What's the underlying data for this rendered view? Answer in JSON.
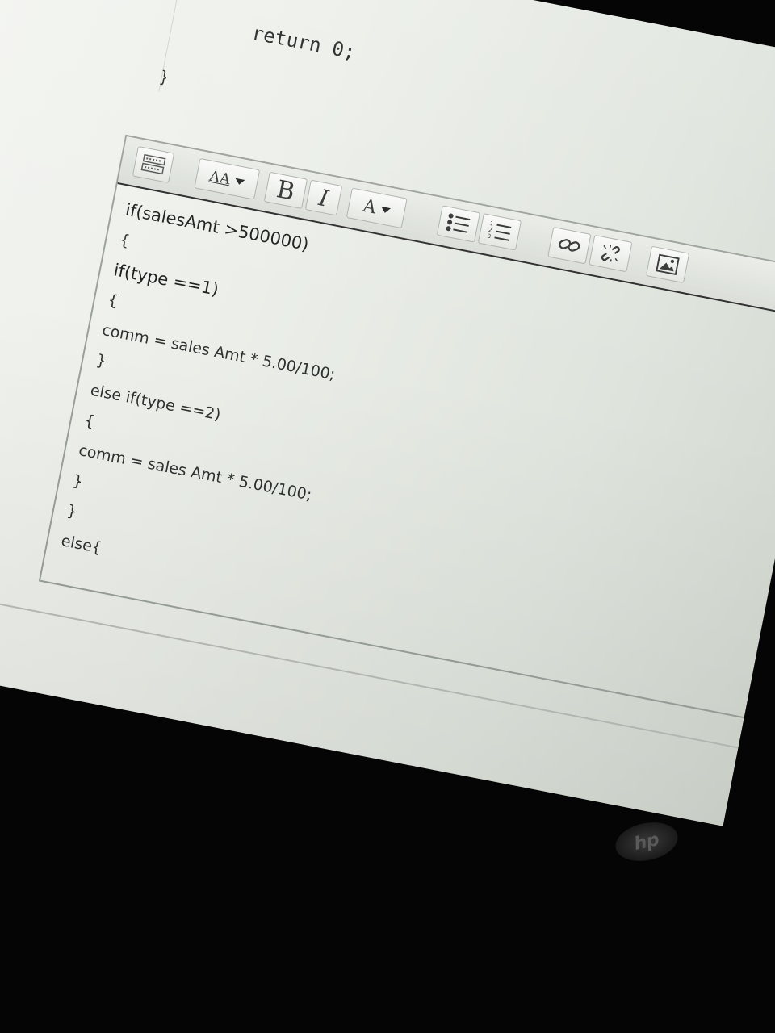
{
  "code_above": {
    "return_line": "return 0;",
    "closing_brace": "}"
  },
  "toolbar": {
    "format_icon": "keyboard-toggle-icon",
    "font_size_label": "AA",
    "bold_label": "B",
    "italic_label": "I",
    "font_color_label": "A",
    "unordered_list_icon": "bullet-list-icon",
    "ordered_list_icon": "numbered-list-icon",
    "link_icon": "link-icon",
    "unlink_icon": "unlink-icon",
    "image_icon": "image-icon"
  },
  "editor": {
    "lines": [
      "if(salesAmt >500000)",
      "{",
      "if(type ==1)",
      "{",
      "comm = sales Amt * 5.00/100;",
      "}",
      "else if(type ==2)",
      "{",
      "comm = sales Amt * 5.00/100;",
      "}",
      "}",
      "else{"
    ]
  },
  "device": {
    "logo_text": "hp"
  }
}
